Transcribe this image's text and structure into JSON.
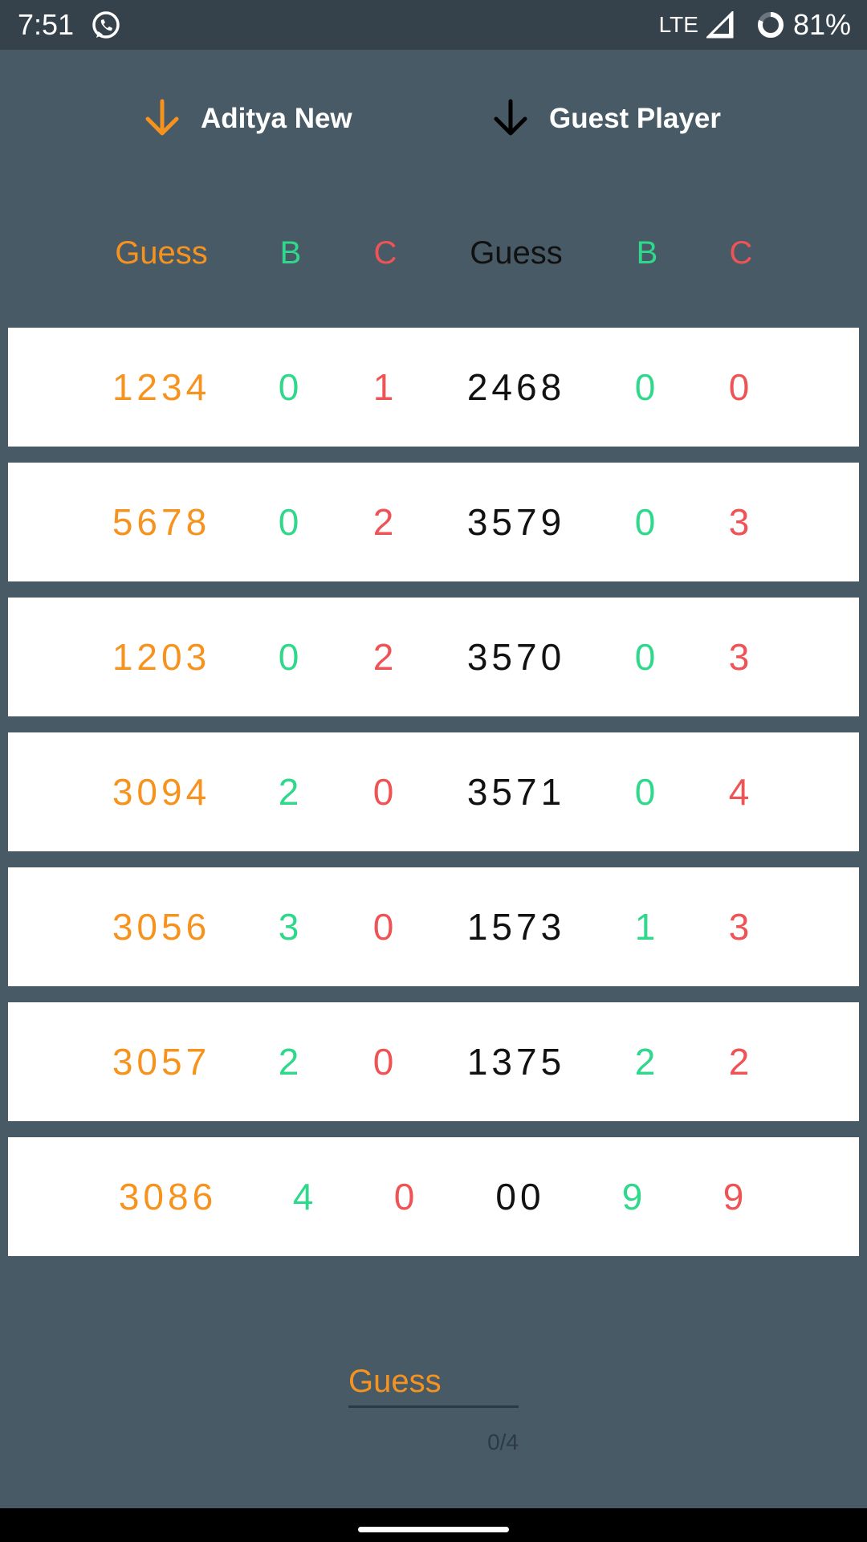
{
  "status_bar": {
    "time": "7:51",
    "network": "LTE",
    "battery": "81%",
    "icons": [
      "whatsapp-icon",
      "signal-icon",
      "battery-icon"
    ]
  },
  "players": [
    {
      "name": "Aditya New",
      "arrow_color": "#f6931f",
      "arrow_icon": "arrow-down-icon"
    },
    {
      "name": "Guest Player",
      "arrow_color": "#000000",
      "arrow_icon": "arrow-down-icon"
    }
  ],
  "headers": [
    "Guess",
    "B",
    "C",
    "Guess",
    "B",
    "C"
  ],
  "rows": [
    [
      "1234",
      "0",
      "1",
      "2468",
      "0",
      "0"
    ],
    [
      "5678",
      "0",
      "2",
      "3579",
      "0",
      "3"
    ],
    [
      "1203",
      "0",
      "2",
      "3570",
      "0",
      "3"
    ],
    [
      "3094",
      "2",
      "0",
      "3571",
      "0",
      "4"
    ],
    [
      "3056",
      "3",
      "0",
      "1573",
      "1",
      "3"
    ],
    [
      "3057",
      "2",
      "0",
      "1375",
      "2",
      "2"
    ],
    [
      "3086",
      "4",
      "0",
      "00",
      "9",
      "9"
    ]
  ],
  "input": {
    "placeholder": "Guess",
    "value": "",
    "counter": "0/4"
  },
  "colors": {
    "background": "#485a66",
    "status_bar": "#36424b",
    "guess": "#f6931f",
    "bulls": "#2fd88a",
    "cows": "#ee5356",
    "opponent_guess": "#111111"
  }
}
